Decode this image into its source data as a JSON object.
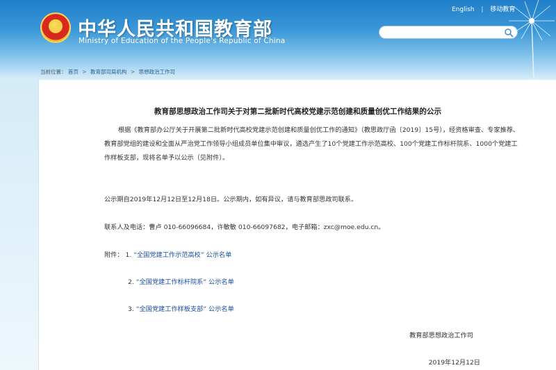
{
  "header": {
    "title": "中华人民共和国教育部",
    "subtitle": "Ministry of Education of the People's Republic of China",
    "nav": {
      "english": "English",
      "mobile": "移动教育"
    },
    "search_placeholder": ""
  },
  "breadcrumb": {
    "label": "当前位置：",
    "items": [
      "首页",
      "教育部司局机构",
      "思想政治工作司"
    ]
  },
  "article": {
    "title": "教育部思想政治工作司关于对第二批新时代高校党建示范创建和质量创优工作结果的公示",
    "p1": "根据《教育部办公厅关于开展第二批新时代高校党建示范创建和质量创优工作的通知》（教思政厅函〔2019〕15号），经资格审查、专家推荐、教育部党组的建设和全面从严治党工作领导小组成员单位集中审议，遴选产生了10个党建工作示范高校、100个党建工作标杆院系、1000个党建工作样板支部，现将名单予以公示（见附件）。",
    "notice": "公示期自2019年12月12日至12月18日。公示期内，如有异议，请与教育部思政司联系。",
    "contact": "联系人及电话：曹卢 010-66096684，许敏敏 010-66097682，电子邮箱：zxc@moe.edu.cn。",
    "attachments_label": "附件：",
    "attachments": [
      {
        "num": "1.",
        "link": "“全国党建工作示范高校”",
        "suffix": "公示名单"
      },
      {
        "num": "2.",
        "link": "“全国党建工作标杆院系”",
        "suffix": "公示名单"
      },
      {
        "num": "3.",
        "link": "“全国党建工作样板支部”",
        "suffix": "公示名单"
      }
    ],
    "signer": "教育部思想政治工作司",
    "date": "2019年12月12日"
  },
  "colors": {
    "header_blue": "#1f7fc9",
    "link": "#1b4fa0",
    "text": "#333333"
  }
}
